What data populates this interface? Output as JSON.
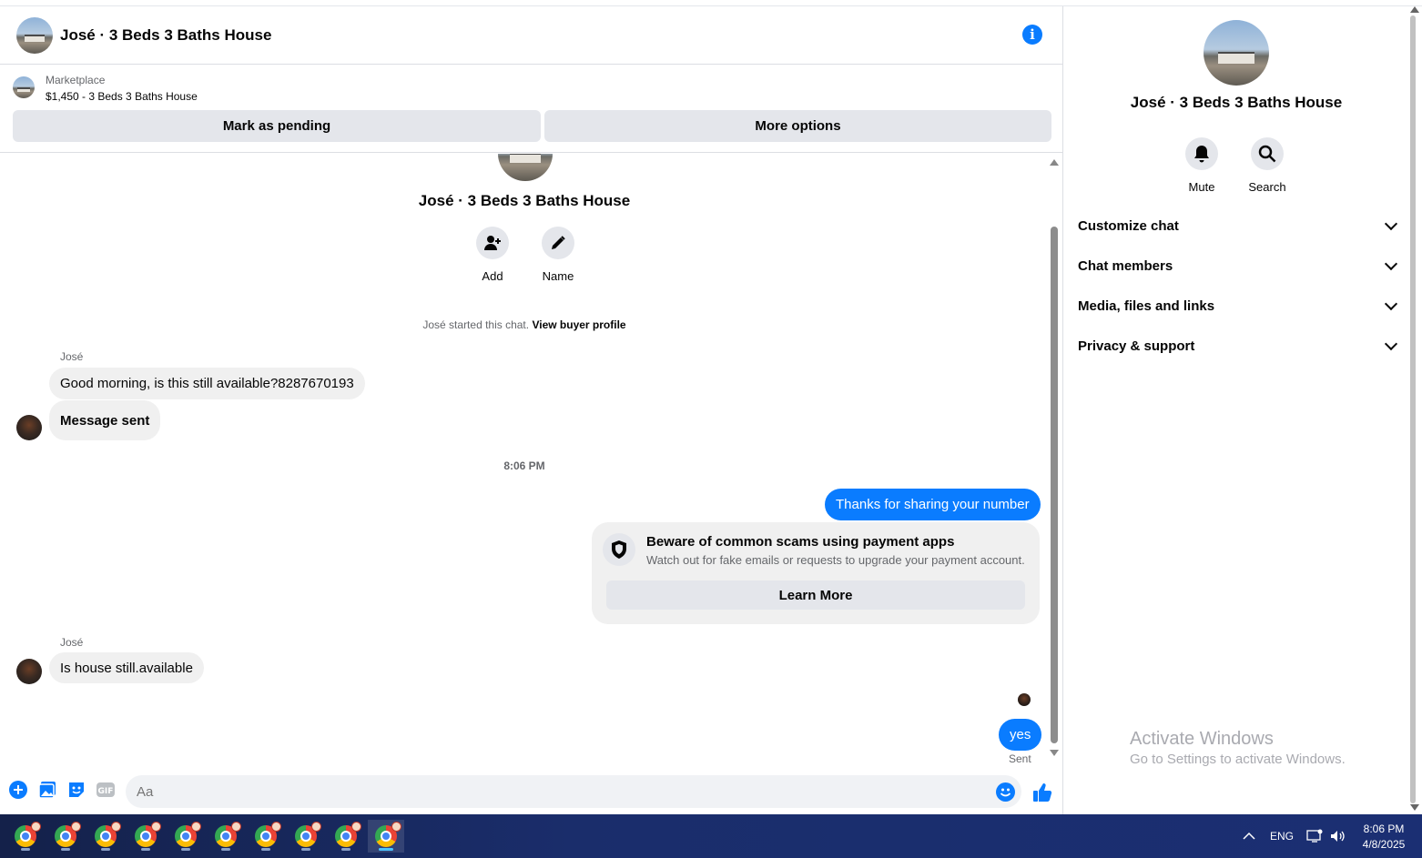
{
  "header": {
    "title": "José · 3 Beds 3 Baths House"
  },
  "marketplace": {
    "label": "Marketplace",
    "listing": "$1,450 - 3 Beds 3 Baths House",
    "mark_pending": "Mark as pending",
    "more_options": "More options"
  },
  "thread": {
    "title": "José · 3 Beds 3 Baths House",
    "actions": [
      {
        "label": "Add",
        "icon": "add-person-icon"
      },
      {
        "label": "Name",
        "icon": "pencil-icon"
      }
    ],
    "started_text": "José started this chat.",
    "view_profile": "View buyer profile",
    "messages": [
      {
        "sender": "José",
        "text": "Good morning, is this still available?8287670193"
      },
      {
        "text": "Message sent"
      }
    ],
    "time_separator": "8:06 PM",
    "outgoing_1": "Thanks for sharing your number",
    "scam_card": {
      "title": "Beware of common scams using payment apps",
      "text": "Watch out for fake emails or requests to upgrade your payment account.",
      "button": "Learn More"
    },
    "incoming_2": {
      "sender": "José",
      "text": "Is house still.available"
    },
    "outgoing_2": "yes",
    "status": "Sent"
  },
  "composer": {
    "placeholder": "Aa"
  },
  "info_panel": {
    "title": "José · 3 Beds 3 Baths House",
    "mute_label": "Mute",
    "search_label": "Search",
    "sections": [
      "Customize chat",
      "Chat members",
      "Media, files and links",
      "Privacy & support"
    ]
  },
  "watermark": {
    "line1": "Activate Windows",
    "line2": "Go to Settings to activate Windows."
  },
  "taskbar": {
    "lang": "ENG",
    "time": "8:06 PM",
    "date": "4/8/2025"
  },
  "colors": {
    "accent": "#0a7cff",
    "bubble_in": "#f0f0f0",
    "button_bg": "#e4e6eb"
  }
}
